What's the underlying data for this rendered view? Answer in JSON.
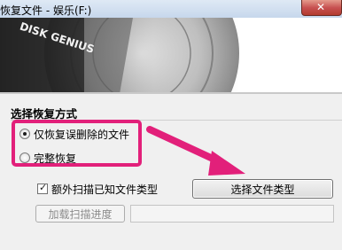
{
  "window": {
    "title": "恢复文件 - 娱乐(F:)",
    "close_icon": "close-icon"
  },
  "banner": {
    "logo_text": "DISK GENIUS"
  },
  "recovery_mode": {
    "section_title": "选择恢复方式",
    "options": [
      {
        "label": "仅恢复误删除的文件",
        "selected": true
      },
      {
        "label": "完整恢复",
        "selected": false
      }
    ]
  },
  "extra_scan": {
    "label": "额外扫描已知文件类型",
    "checked": true,
    "choose_type_button": "选择文件类型"
  },
  "load_progress": {
    "button_label": "加载扫描进度",
    "path_value": ""
  },
  "annotation": {
    "highlight_color": "#e2207a",
    "arrow_color": "#e2207a"
  }
}
